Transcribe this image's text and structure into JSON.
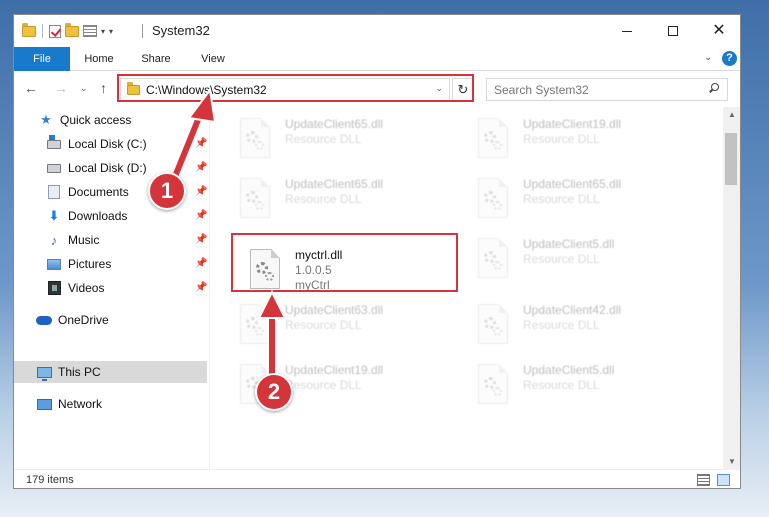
{
  "titlebar": {
    "title": "System32",
    "minimize": "—",
    "close": "✕"
  },
  "ribbon": {
    "tabs": [
      "File",
      "Home",
      "Share",
      "View"
    ],
    "help": "?"
  },
  "nav": {
    "back": "←",
    "forward": "→",
    "recent": "⌄",
    "up": "↑",
    "address": "C:\\Windows\\System32",
    "refresh": "↻",
    "search_placeholder": "Search System32"
  },
  "sidebar": {
    "items": [
      {
        "label": "Quick access",
        "icon": "star-icon"
      },
      {
        "label": "Local Disk (C:)",
        "icon": "drive-icon"
      },
      {
        "label": "Local Disk (D:)",
        "icon": "drive-icon"
      },
      {
        "label": "Documents",
        "icon": "documents-icon"
      },
      {
        "label": "Downloads",
        "icon": "downloads-icon"
      },
      {
        "label": "Music",
        "icon": "music-icon"
      },
      {
        "label": "Pictures",
        "icon": "pictures-icon"
      },
      {
        "label": "Videos",
        "icon": "videos-icon"
      },
      {
        "label": "OneDrive",
        "icon": "cloud-icon"
      },
      {
        "label": "This PC",
        "icon": "pc-icon"
      },
      {
        "label": "Network",
        "icon": "network-icon"
      }
    ],
    "selected": "This PC"
  },
  "files": [
    {
      "name": "UpdateClient65.dll",
      "line2": "Resource DLL",
      "line3": ""
    },
    {
      "name": "UpdateClient19.dll",
      "line2": "Resource DLL",
      "line3": ""
    },
    {
      "name": "UpdateClient65.dll",
      "line2": "Resource DLL",
      "line3": ""
    },
    {
      "name": "UpdateClient65.dll",
      "line2": "Resource DLL",
      "line3": ""
    },
    {
      "name": "myctrl.dll",
      "line2": "1.0.0.5",
      "line3": "myCtrl"
    },
    {
      "name": "UpdateClient5.dll",
      "line2": "Resource DLL",
      "line3": ""
    },
    {
      "name": "UpdateClient63.dll",
      "line2": "Resource DLL",
      "line3": ""
    },
    {
      "name": "UpdateClient42.dll",
      "line2": "Resource DLL",
      "line3": ""
    },
    {
      "name": "UpdateClient19.dll",
      "line2": "Resource DLL",
      "line3": ""
    },
    {
      "name": "UpdateClient5.dll",
      "line2": "Resource DLL",
      "line3": ""
    }
  ],
  "status": {
    "item_count": "179 items"
  },
  "annotations": {
    "step1": "1",
    "step2": "2",
    "color": "#d4353a"
  }
}
